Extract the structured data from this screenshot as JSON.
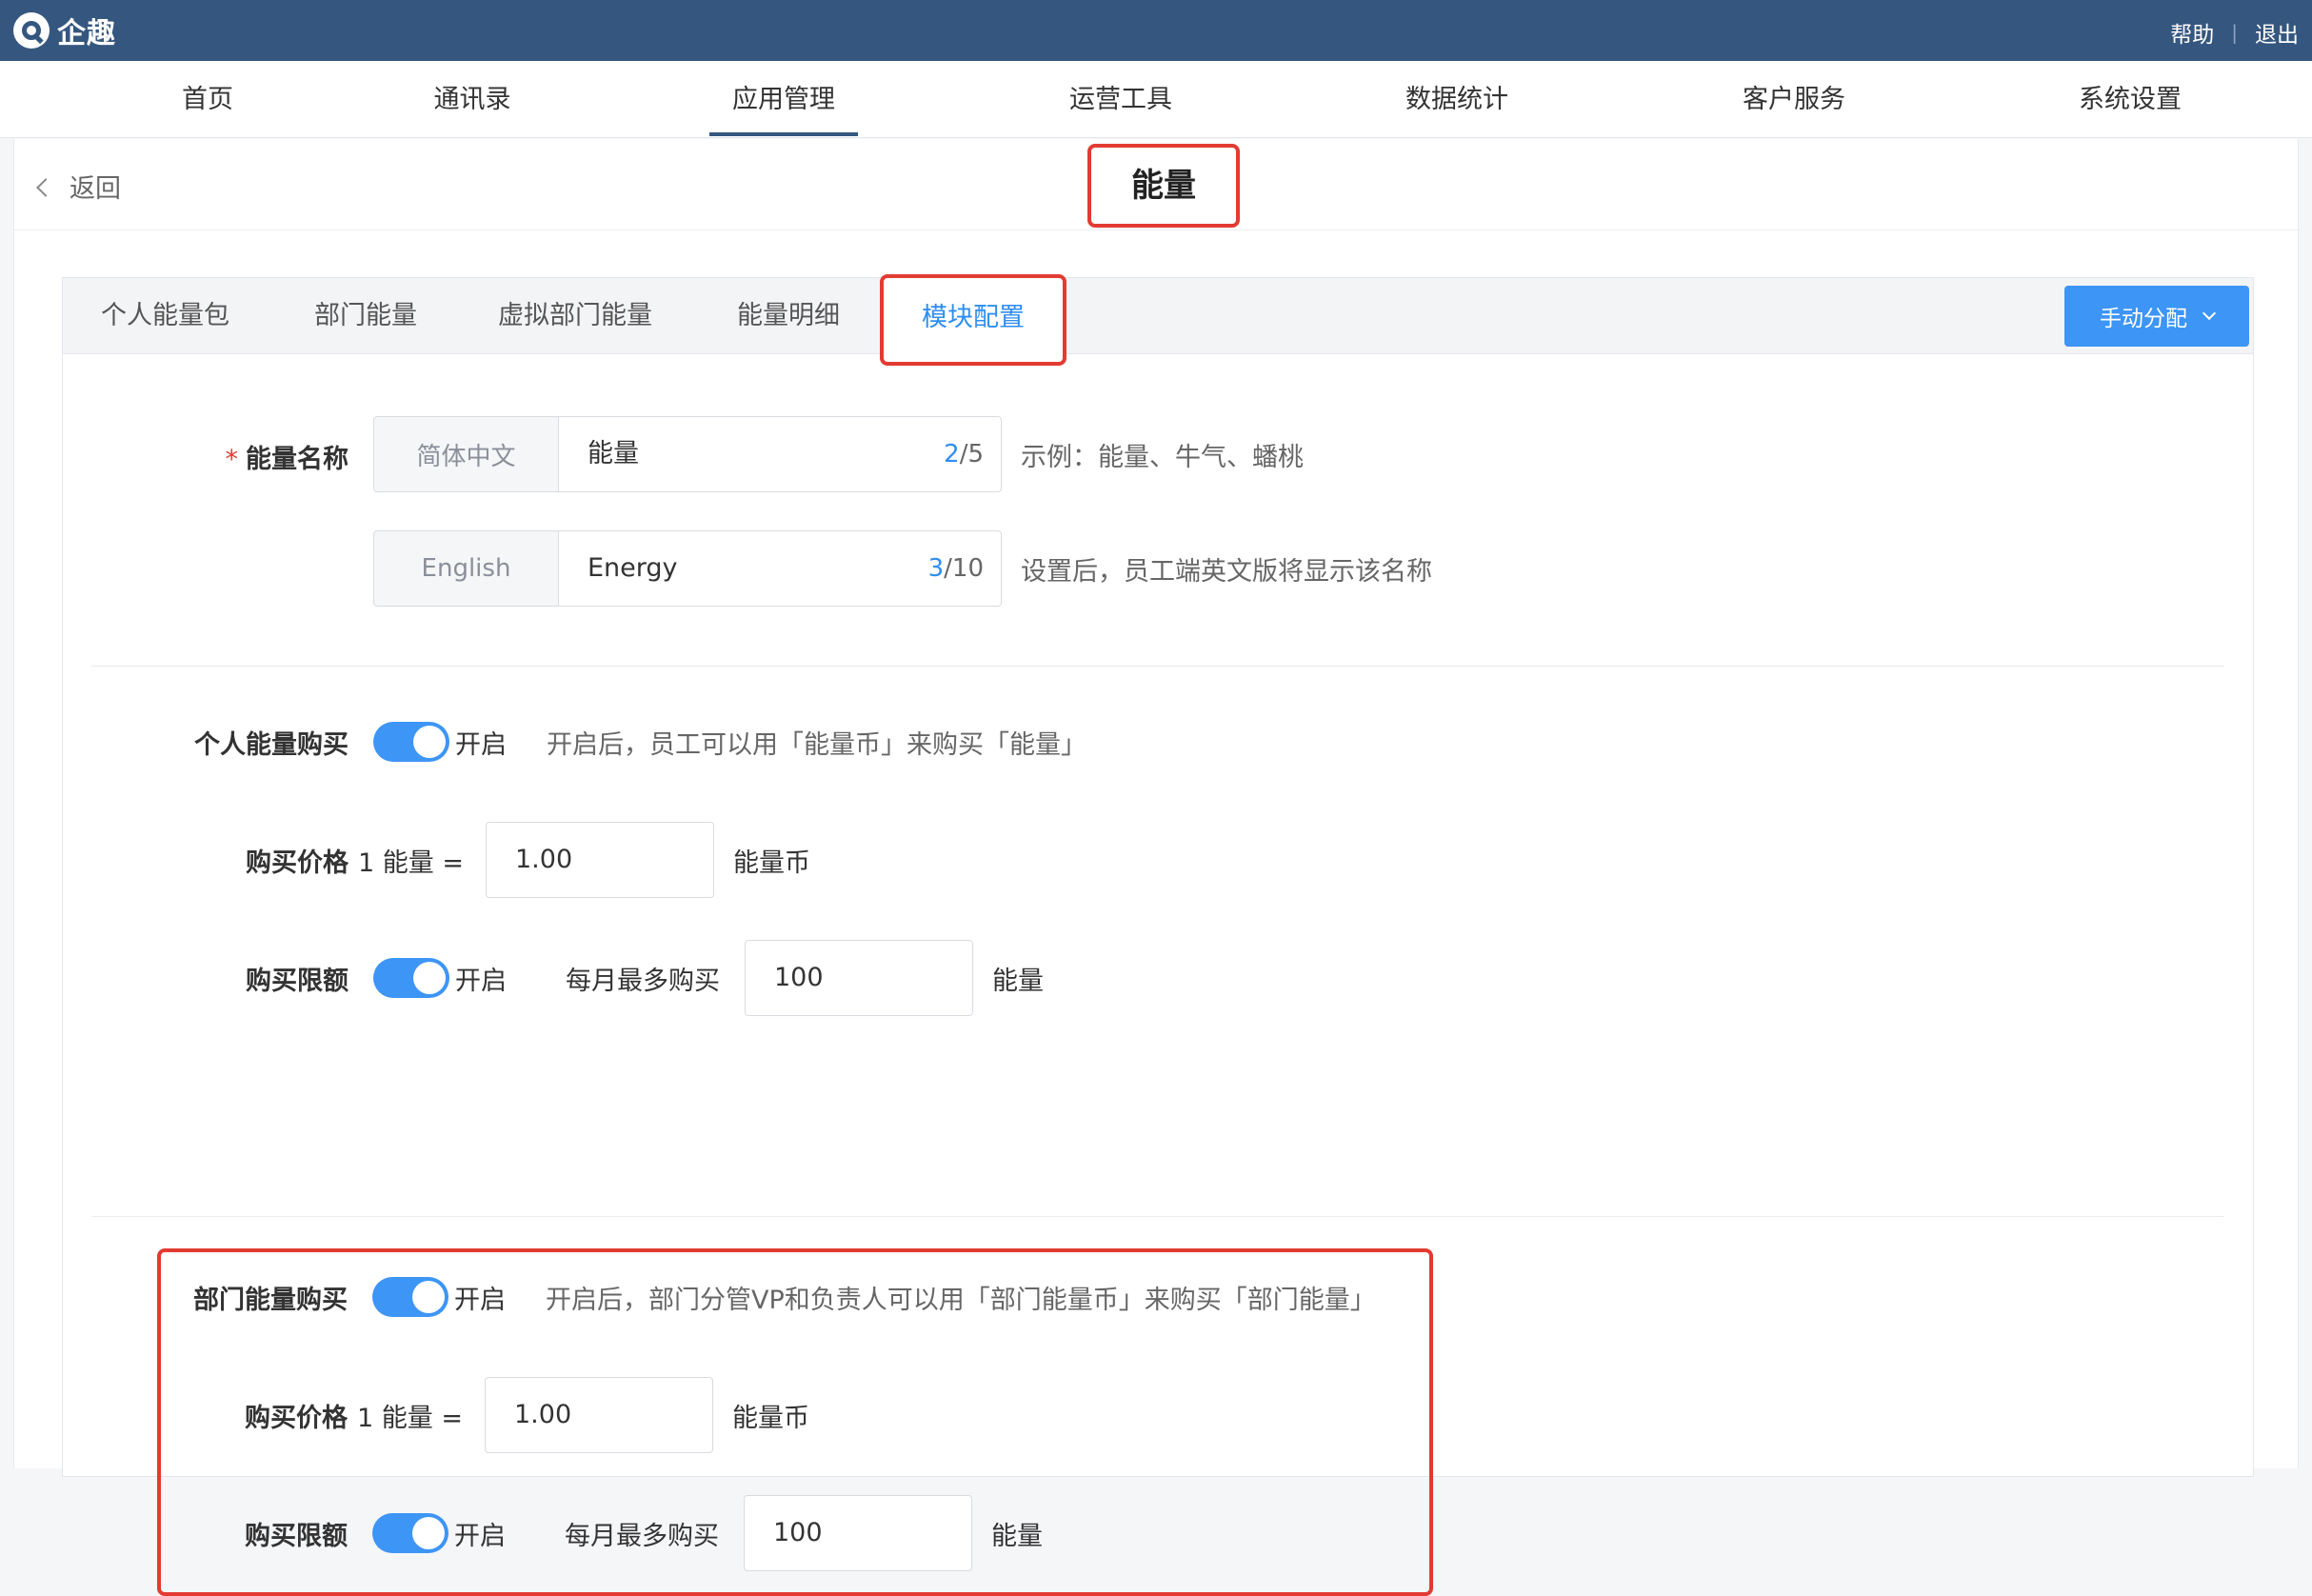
{
  "topbar": {
    "brand": "企趣",
    "help": "帮助",
    "logout": "退出"
  },
  "nav": [
    {
      "label": "首页"
    },
    {
      "label": "通讯录"
    },
    {
      "label": "应用管理"
    },
    {
      "label": "运营工具"
    },
    {
      "label": "数据统计"
    },
    {
      "label": "客户服务"
    },
    {
      "label": "系统设置"
    }
  ],
  "nav_active": "应用管理",
  "header": {
    "back": "返回",
    "title": "能量"
  },
  "tabs": [
    {
      "label": "个人能量包"
    },
    {
      "label": "部门能量"
    },
    {
      "label": "虚拟部门能量"
    },
    {
      "label": "能量明细"
    },
    {
      "label": "模块配置"
    }
  ],
  "tab_active": "模块配置",
  "manual_button": "手动分配",
  "name_section": {
    "label": "能量名称",
    "required_mark": "*",
    "zh": {
      "tag": "简体中文",
      "value": "能量",
      "count": "2",
      "max": "/5",
      "hint": "示例：能量、牛气、蟠桃"
    },
    "en": {
      "tag": "English",
      "value": "Energy",
      "count": "3",
      "max": "/10",
      "hint": "设置后，员工端英文版将显示该名称"
    }
  },
  "personal": {
    "label": "个人能量购买",
    "toggle_text": "开启",
    "hint": "开启后，员工可以用「能量币」来购买「能量」",
    "price_label": "购买价格",
    "price_prefix": "1 能量 =",
    "price_value": "1.00",
    "price_unit": "能量币",
    "limit_label": "购买限额",
    "limit_toggle_text": "开启",
    "limit_prefix": "每月最多购买",
    "limit_value": "100",
    "limit_unit": "能量"
  },
  "department": {
    "label": "部门能量购买",
    "toggle_text": "开启",
    "hint": "开启后，部门分管VP和负责人可以用「部门能量币」来购买「部门能量」",
    "price_label": "购买价格",
    "price_prefix": "1 能量 =",
    "price_value": "1.00",
    "price_unit": "能量币",
    "limit_label": "购买限额",
    "limit_toggle_text": "开启",
    "limit_prefix": "每月最多购买",
    "limit_value": "100",
    "limit_unit": "能量"
  },
  "colors": {
    "topbar": "#35577f",
    "accent": "#3d95f5",
    "highlight": "#e23b32"
  }
}
